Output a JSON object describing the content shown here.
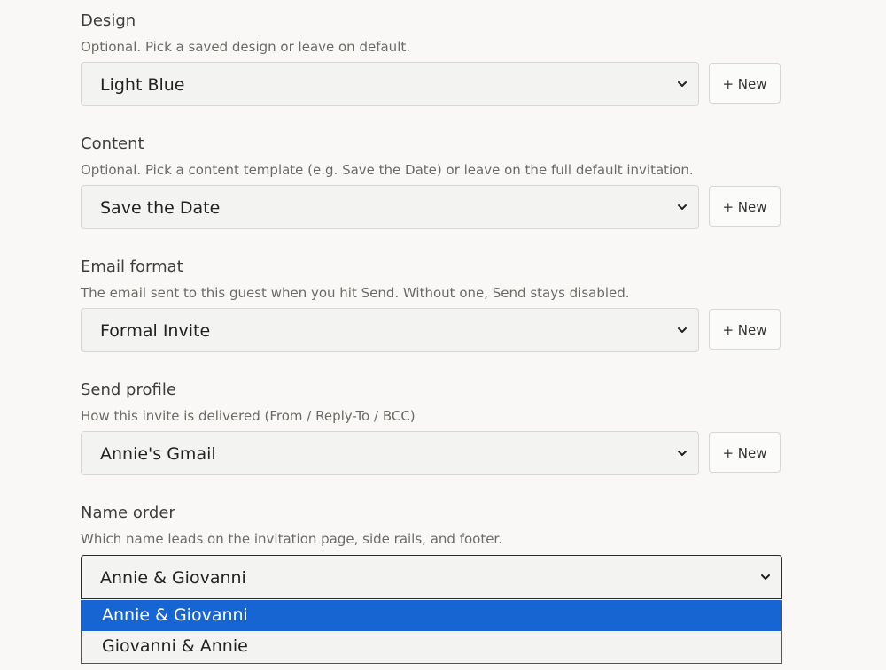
{
  "fields": [
    {
      "label": "Design",
      "help": "Optional. Pick a saved design or leave on default.",
      "value": "Light Blue",
      "new_label": "+ New"
    },
    {
      "label": "Content",
      "help": "Optional. Pick a content template (e.g. Save the Date) or leave on the full default invitation.",
      "value": "Save the Date",
      "new_label": "+ New"
    },
    {
      "label": "Email format",
      "help": "The email sent to this guest when you hit Send. Without one, Send stays disabled.",
      "value": "Formal Invite",
      "new_label": "+ New"
    },
    {
      "label": "Send profile",
      "help": "How this invite is delivered (From / Reply-To / BCC)",
      "value": "Annie's Gmail",
      "new_label": "+ New"
    }
  ],
  "name_order": {
    "label": "Name order",
    "help": "Which name leads on the invitation page, side rails, and footer.",
    "value": "Annie & Giovanni",
    "options": [
      "Annie & Giovanni",
      "Giovanni & Annie"
    ],
    "selected_option": "Annie & Giovanni"
  },
  "colors": {
    "background": "#f9f8f6",
    "select_bg": "#f3f3f2",
    "highlight": "#1765d2"
  },
  "icons": {
    "select_arrow": "chevron-down-icon"
  }
}
